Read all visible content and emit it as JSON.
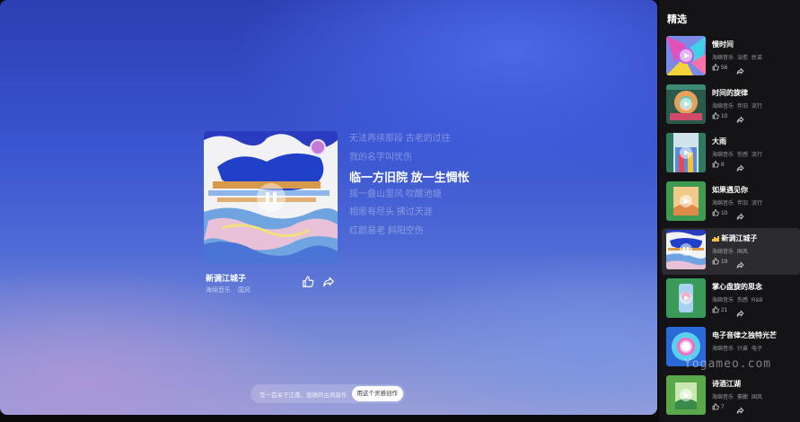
{
  "player": {
    "song_title": "新调江城子",
    "tags": [
      "海绵音乐",
      "国风"
    ],
    "lyrics": [
      {
        "text": "无法再续那段 古老的过往",
        "active": false
      },
      {
        "text": "我的名字叫忧伤",
        "active": false
      },
      {
        "text": "临一方旧院 放一生惆怅",
        "active": true
      },
      {
        "text": "摇一叠山里风 吹醒池塘",
        "active": false
      },
      {
        "text": "相思有尽头 拂过天涯",
        "active": false
      },
      {
        "text": "红颜易老 斜阳空伤",
        "active": false
      }
    ],
    "prompt_text": "写一首关于江南、悠扬的古风音乐",
    "prompt_button": "用这个灵感创作"
  },
  "panel": {
    "title": "精选",
    "items": [
      {
        "title": "慢时间",
        "tags": [
          "海绵音乐",
          "治愈",
          "民谣"
        ],
        "likes": "56",
        "active": false
      },
      {
        "title": "时间的旋律",
        "tags": [
          "海绵音乐",
          "伴旧",
          "流行"
        ],
        "likes": "10",
        "active": false
      },
      {
        "title": "大雨",
        "tags": [
          "海绵音乐",
          "伤感",
          "流行"
        ],
        "likes": "8",
        "active": false
      },
      {
        "title": "如果遇见你",
        "tags": [
          "海绵音乐",
          "伴旧",
          "流行"
        ],
        "likes": "10",
        "active": false
      },
      {
        "title": "新调江城子",
        "tags": [
          "海绵音乐",
          "国风"
        ],
        "likes": "19",
        "active": true
      },
      {
        "title": "掌心盘旋的思念",
        "tags": [
          "海绵音乐",
          "伤感",
          "R&B"
        ],
        "likes": "21",
        "active": false
      },
      {
        "title": "电子音律之独特光芒",
        "tags": [
          "海绵音乐",
          "兴奋",
          "电子"
        ],
        "likes": "",
        "active": false
      },
      {
        "title": "诗酒江湖",
        "tags": [
          "海绵音乐",
          "豪酣",
          "国风"
        ],
        "likes": "7",
        "active": false
      }
    ]
  },
  "watermark": "Yogameo.com",
  "colors": {
    "accent_eq": "#f4c23a",
    "panel_bg": "#141416",
    "stage_blue": "#3a55d0"
  }
}
